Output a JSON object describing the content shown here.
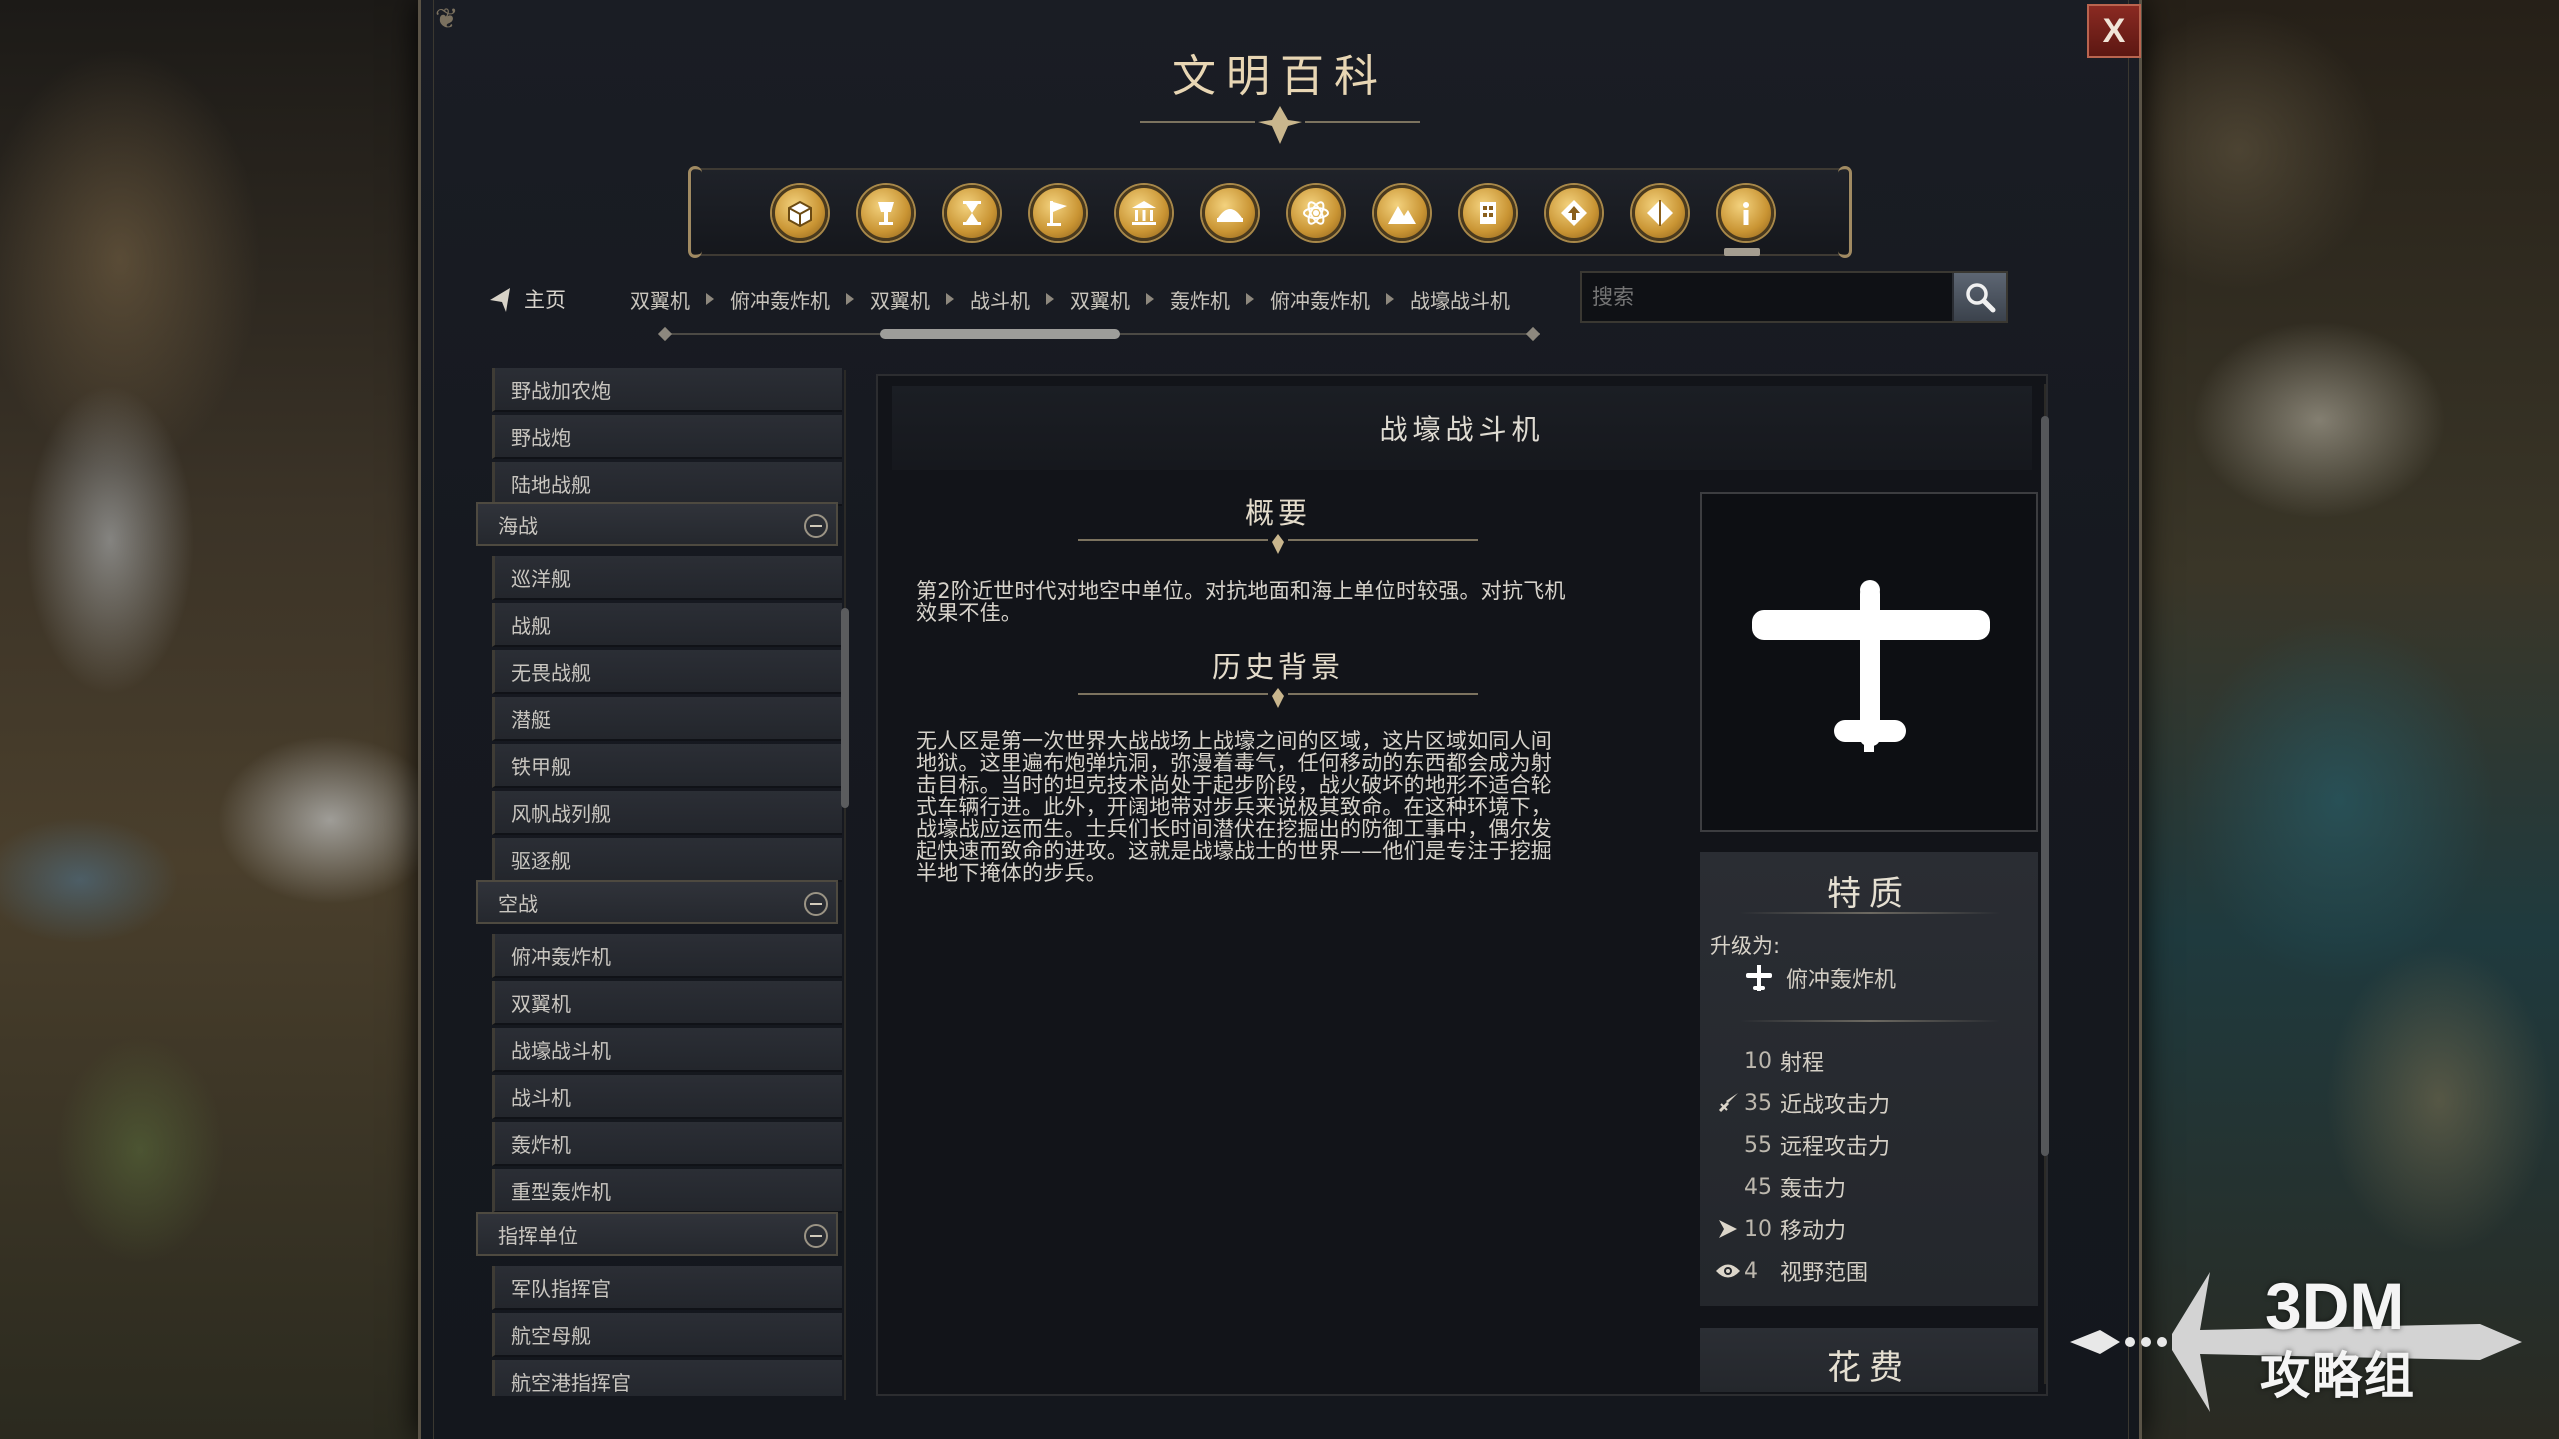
{
  "window": {
    "title": "文明百科",
    "close_label": "X"
  },
  "categories": [
    {
      "name": "units",
      "icon": "crate-icon"
    },
    {
      "name": "wonders",
      "icon": "goblet-icon"
    },
    {
      "name": "eras",
      "icon": "hourglass-icon"
    },
    {
      "name": "civilizations",
      "icon": "flag-icon"
    },
    {
      "name": "districts",
      "icon": "temple-icon"
    },
    {
      "name": "infrastructure",
      "icon": "dome-icon"
    },
    {
      "name": "technology",
      "icon": "atom-icon"
    },
    {
      "name": "terrain",
      "icon": "mountain-icon"
    },
    {
      "name": "buildings",
      "icon": "building-icon"
    },
    {
      "name": "progression",
      "icon": "up-arrow-icon"
    },
    {
      "name": "resources",
      "icon": "diamond-icon"
    },
    {
      "name": "info",
      "icon": "info-icon"
    }
  ],
  "nav": {
    "home_label": "主页",
    "breadcrumbs": [
      "双翼机",
      "俯冲轰炸机",
      "双翼机",
      "战斗机",
      "双翼机",
      "轰炸机",
      "俯冲轰炸机",
      "战壕战斗机"
    ],
    "search_placeholder": "搜索"
  },
  "list": {
    "items_top": [
      "野战加农炮",
      "野战炮",
      "陆地战舰"
    ],
    "groups": [
      {
        "label": "海战",
        "items": [
          "巡洋舰",
          "战舰",
          "无畏战舰",
          "潜艇",
          "铁甲舰",
          "风帆战列舰",
          "驱逐舰"
        ]
      },
      {
        "label": "空战",
        "items": [
          "俯冲轰炸机",
          "双翼机",
          "战壕战斗机",
          "战斗机",
          "轰炸机",
          "重型轰炸机"
        ]
      },
      {
        "label": "指挥单位",
        "items": [
          "军队指挥官",
          "航空母舰",
          "航空港指挥官"
        ]
      }
    ]
  },
  "detail": {
    "title": "战壕战斗机",
    "overview_heading": "概要",
    "overview_lines": [
      "第2阶近世时代对地空中单位。对抗地面和海上单位时较强。对抗飞机",
      "效果不佳。"
    ],
    "history_heading": "历史背景",
    "history_lines": [
      "无人区是第一次世界大战战场上战壕之间的区域，这片区域如同人间",
      "地狱。这里遍布炮弹坑洞，弥漫着毒气，任何移动的东西都会成为射",
      "击目标。当时的坦克技术尚处于起步阶段，战火破坏的地形不适合轮",
      "式车辆行进。此外，开阔地带对步兵来说极其致命。在这种环境下，",
      "战壕战应运而生。士兵们长时间潜伏在挖掘出的防御工事中，偶尔发",
      "起快速而致命的进攻。这就是战壕战士的世界——他们是专注于挖掘",
      "半地下掩体的步兵。"
    ],
    "traits_title": "特质",
    "upgrade_label": "升级为:",
    "upgrade_target": "俯冲轰炸机",
    "stats": [
      {
        "value": "10",
        "label": "射程",
        "icon": ""
      },
      {
        "value": "35",
        "label": "近战攻击力",
        "icon": "sword-icon"
      },
      {
        "value": "55",
        "label": "远程攻击力",
        "icon": ""
      },
      {
        "value": "45",
        "label": "轰击力",
        "icon": ""
      },
      {
        "value": "10",
        "label": "移动力",
        "icon": "movement-arrow-icon"
      },
      {
        "value": "4",
        "label": "视野范围",
        "icon": "eye-icon"
      }
    ],
    "cost_title": "花费"
  },
  "watermark": {
    "big": "3DM",
    "small": "攻略组"
  }
}
